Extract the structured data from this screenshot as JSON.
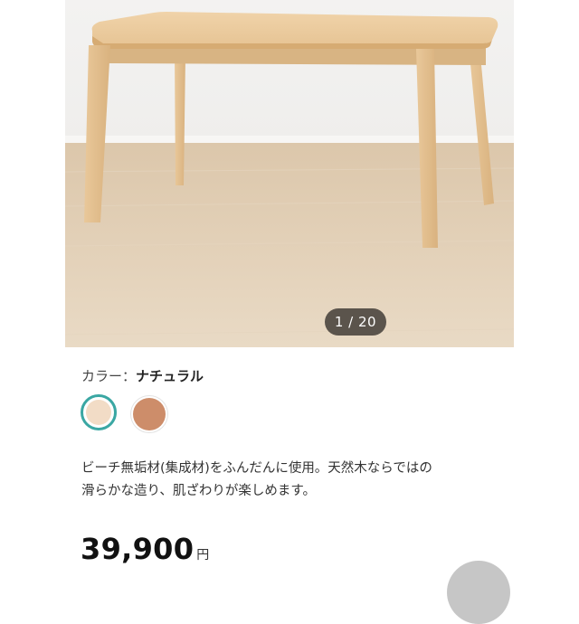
{
  "gallery": {
    "counter": "1 / 20"
  },
  "color": {
    "label": "カラー：",
    "value": "ナチュラル",
    "swatches": [
      {
        "name": "ナチュラル",
        "color": "#f2dcc6",
        "selected": true
      },
      {
        "name": "",
        "color": "#cd8d6a",
        "selected": false
      }
    ]
  },
  "description": {
    "line1": "ビーチ無垢材(集成材)をふんだんに使用。天然木ならではの",
    "line2": "滑らかな造り、肌ざわりが楽しめます。"
  },
  "price": {
    "value": "39,900",
    "currency": "円"
  },
  "colors": {
    "accent": "#3aa7a3",
    "counter_bg": "#3c3732"
  }
}
